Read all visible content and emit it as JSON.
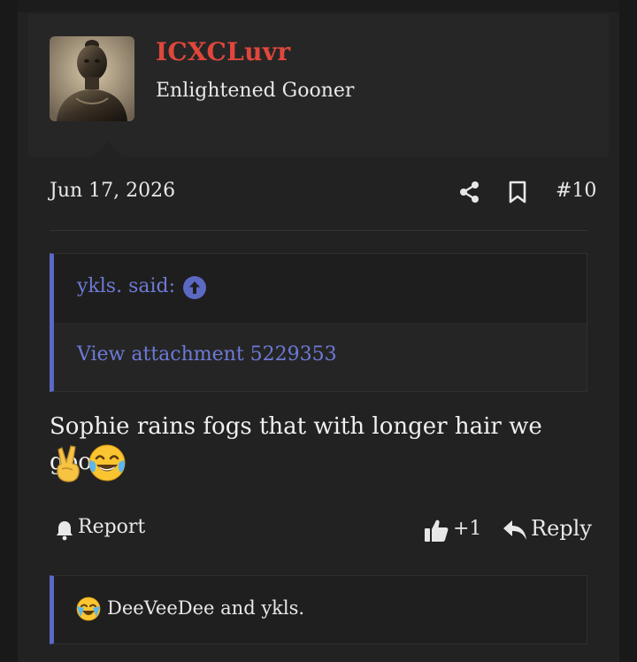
{
  "user": {
    "name": "ICXCLuvr",
    "title": "Enlightened Gooner"
  },
  "post": {
    "date": "Jun 17, 2026",
    "number": "#10",
    "quote": {
      "author": "ykls. said:",
      "attachment_text": "View attachment 5229353"
    },
    "message": "Sophie rains fogs that with longer hair we good",
    "emojis": [
      "victory-hand",
      "face-with-tears-of-joy"
    ]
  },
  "actions": {
    "report_label": "Report",
    "like_count": "+1",
    "reply_label": "Reply"
  },
  "reactions": {
    "emoji": "loudly-crying-laughing",
    "text": "DeeVeeDee and ykls."
  },
  "colors": {
    "username": "#e0473c",
    "link": "#6d7ad6",
    "accent_border": "#5b69c2",
    "background": "#222222"
  }
}
